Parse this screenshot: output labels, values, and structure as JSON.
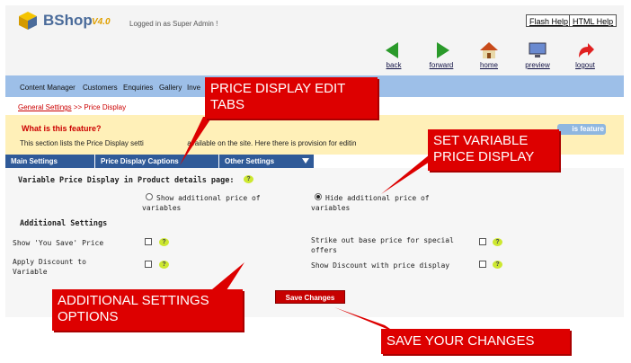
{
  "header": {
    "logo": "BShop",
    "version": "V4.0",
    "logged_in": "Logged in as Super Admin !",
    "flash_help": "Flash Help",
    "html_help": "HTML Help",
    "toolbar": [
      {
        "label": "back",
        "icon": "back-arrow-icon"
      },
      {
        "label": "forward",
        "icon": "forward-arrow-icon"
      },
      {
        "label": "home",
        "icon": "home-icon"
      },
      {
        "label": "preview",
        "icon": "preview-icon"
      },
      {
        "label": "logout",
        "icon": "logout-icon"
      }
    ]
  },
  "nav": {
    "items": [
      "Content Manager",
      "Customers",
      "Enquiries",
      "Gallery",
      "Inve"
    ]
  },
  "breadcrumb": {
    "link": "General Settings",
    "separator": ">>",
    "current": "Price Display"
  },
  "info": {
    "title": "What is this feature?",
    "text": "This section lists the Price Display setti",
    "text_tail": "available on the site. Here there is provision for editin",
    "feature_button": "is feature"
  },
  "tabs": [
    "Main Settings",
    "Price Display Captions",
    "Other Settings"
  ],
  "variable_section": {
    "title": "Variable Price Display in Product details page:",
    "option_show": "Show additional price of variables",
    "option_hide": "Hide additional price of variables",
    "selected": "hide"
  },
  "additional": {
    "title": "Additional Settings",
    "show_you_save": "Show 'You Save' Price",
    "apply_discount": "Apply Discount to Variable",
    "strike_out": "Strike out base price for special offers",
    "show_discount": "Show Discount with price display"
  },
  "save_button": "Save Changes",
  "callouts": {
    "tabs": "PRICE DISPLAY EDIT TABS",
    "variable": "SET VARIABLE PRICE DISPLAY",
    "additional": "ADDITIONAL SETTINGS OPTIONS",
    "save": "SAVE YOUR CHANGES"
  },
  "colors": {
    "callout": "#dd0000",
    "nav": "#9dbfe8",
    "tab": "#2f5a98",
    "info": "#fff0b8"
  }
}
